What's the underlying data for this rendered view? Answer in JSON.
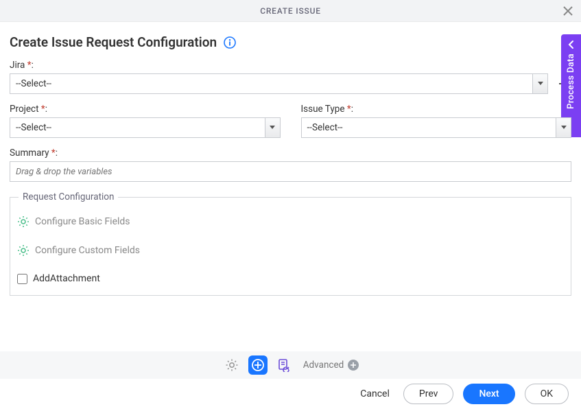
{
  "dialog": {
    "title": "CREATE ISSUE"
  },
  "side_tab": {
    "label": "Process Data"
  },
  "page_title": "Create Issue Request Configuration",
  "fields": {
    "jira": {
      "label": "Jira",
      "required_marker": "*",
      "value": "--Select--"
    },
    "project": {
      "label": "Project",
      "required_marker": "*",
      "value": "--Select--"
    },
    "issue_type": {
      "label": "Issue Type",
      "required_marker": "*",
      "value": "--Select--"
    },
    "summary": {
      "label": "Summary",
      "required_marker": "*",
      "placeholder": "Drag & drop the variables"
    }
  },
  "request_config": {
    "legend": "Request Configuration",
    "basic": "Configure Basic Fields",
    "custom": "Configure Custom Fields",
    "addattachment": "AddAttachment"
  },
  "toolbar": {
    "advanced": "Advanced"
  },
  "footer": {
    "cancel": "Cancel",
    "prev": "Prev",
    "next": "Next",
    "ok": "OK"
  }
}
